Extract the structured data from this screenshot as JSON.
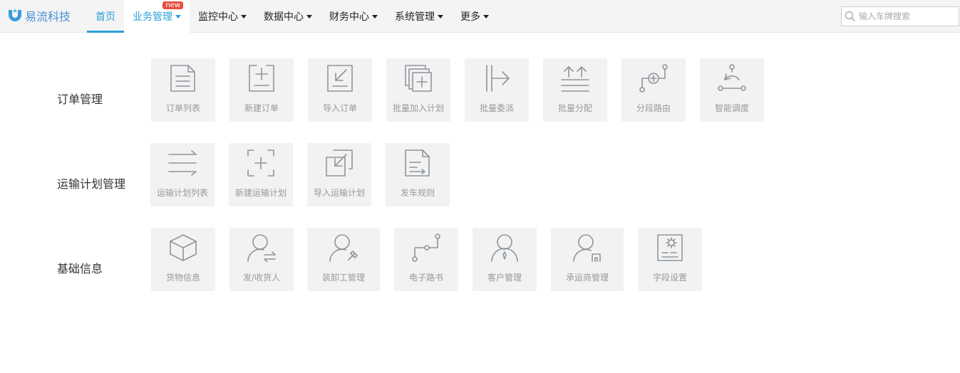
{
  "brand": {
    "name": "易流科技"
  },
  "nav": {
    "home": "首页",
    "business": "业务管理",
    "business_badge": "new",
    "monitor": "监控中心",
    "data": "数据中心",
    "finance": "财务中心",
    "system": "系统管理",
    "more": "更多"
  },
  "search": {
    "placeholder": "输入车牌搜索"
  },
  "sections": {
    "order": {
      "title": "订单管理",
      "items": [
        "订单列表",
        "新建订单",
        "导入订单",
        "批量加入计划",
        "批量委派",
        "批量分配",
        "分段路由",
        "智能调度"
      ]
    },
    "plan": {
      "title": "运输计划管理",
      "items": [
        "运输计划列表",
        "新建运输计划",
        "导入运输计划",
        "发车规则"
      ]
    },
    "base": {
      "title": "基础信息",
      "items": [
        "货物信息",
        "发/收货人",
        "装卸工管理",
        "电子路书",
        "客户管理",
        "承运商管理",
        "字段设置"
      ]
    }
  },
  "colors": {
    "accent": "#2a9fd8",
    "badge": "#e84c3d",
    "tile_bg": "#f2f2f2",
    "icon": "#8e959c"
  }
}
